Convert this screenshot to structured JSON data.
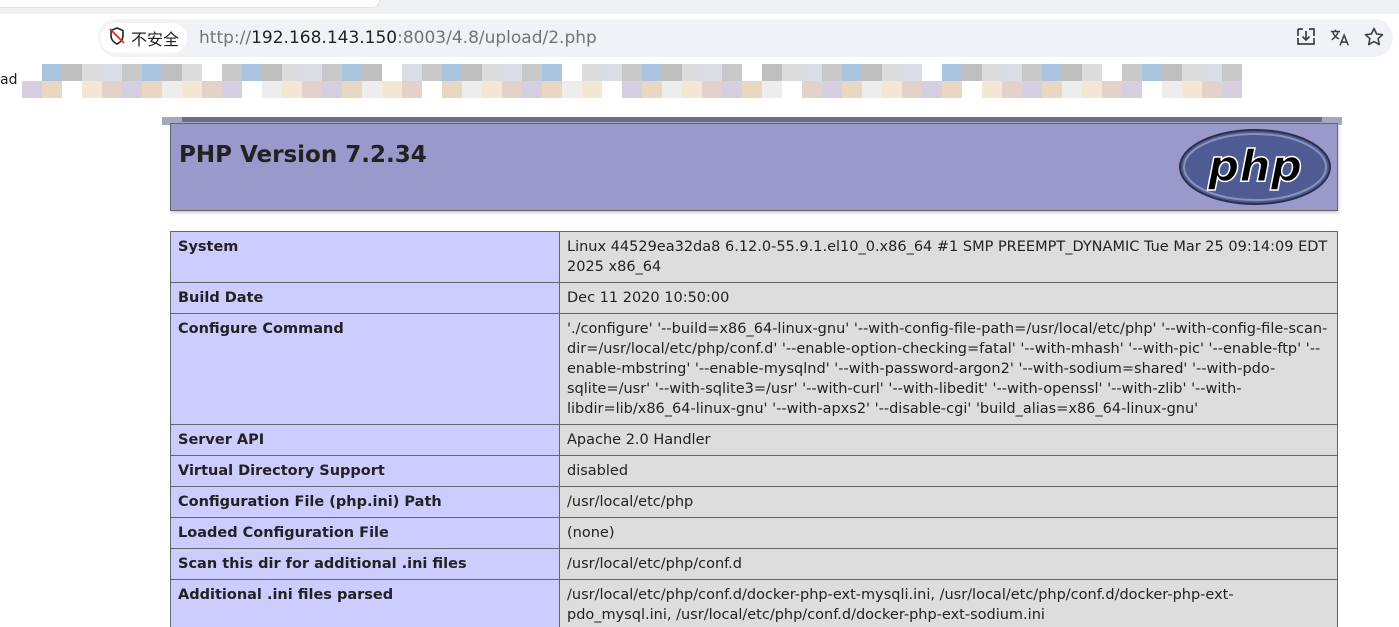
{
  "browser": {
    "security_label": "不安全",
    "url_scheme": "http://",
    "url_host": "192.168.143.150",
    "url_rest": ":8003/4.8/upload/2.php",
    "bookmark_label": "ad",
    "icons": [
      "not-secure-icon",
      "download-icon",
      "translate-icon",
      "bookmark-star-icon"
    ]
  },
  "phpinfo": {
    "title": "PHP Version 7.2.34",
    "logo_text": "php",
    "colors": {
      "header_bg": "#9999cc",
      "key_bg": "#ccccff",
      "value_bg": "#dddddd"
    },
    "rows": [
      {
        "key": "System",
        "value": "Linux 44529ea32da8 6.12.0-55.9.1.el10_0.x86_64 #1 SMP PREEMPT_DYNAMIC Tue Mar 25 09:14:09 EDT 2025 x86_64"
      },
      {
        "key": "Build Date",
        "value": "Dec 11 2020 10:50:00"
      },
      {
        "key": "Configure Command",
        "value": "'./configure' '--build=x86_64-linux-gnu' '--with-config-file-path=/usr/local/etc/php' '--with-config-file-scan-dir=/usr/local/etc/php/conf.d' '--enable-option-checking=fatal' '--with-mhash' '--with-pic' '--enable-ftp' '--enable-mbstring' '--enable-mysqlnd' '--with-password-argon2' '--with-sodium=shared' '--with-pdo-sqlite=/usr' '--with-sqlite3=/usr' '--with-curl' '--with-libedit' '--with-openssl' '--with-zlib' '--with-libdir=lib/x86_64-linux-gnu' '--with-apxs2' '--disable-cgi' 'build_alias=x86_64-linux-gnu'"
      },
      {
        "key": "Server API",
        "value": "Apache 2.0 Handler"
      },
      {
        "key": "Virtual Directory Support",
        "value": "disabled"
      },
      {
        "key": "Configuration File (php.ini) Path",
        "value": "/usr/local/etc/php"
      },
      {
        "key": "Loaded Configuration File",
        "value": "(none)"
      },
      {
        "key": "Scan this dir for additional .ini files",
        "value": "/usr/local/etc/php/conf.d"
      },
      {
        "key": "Additional .ini files parsed",
        "value": "/usr/local/etc/php/conf.d/docker-php-ext-mysqli.ini, /usr/local/etc/php/conf.d/docker-php-ext-pdo_mysql.ini, /usr/local/etc/php/conf.d/docker-php-ext-sodium.ini"
      }
    ]
  }
}
